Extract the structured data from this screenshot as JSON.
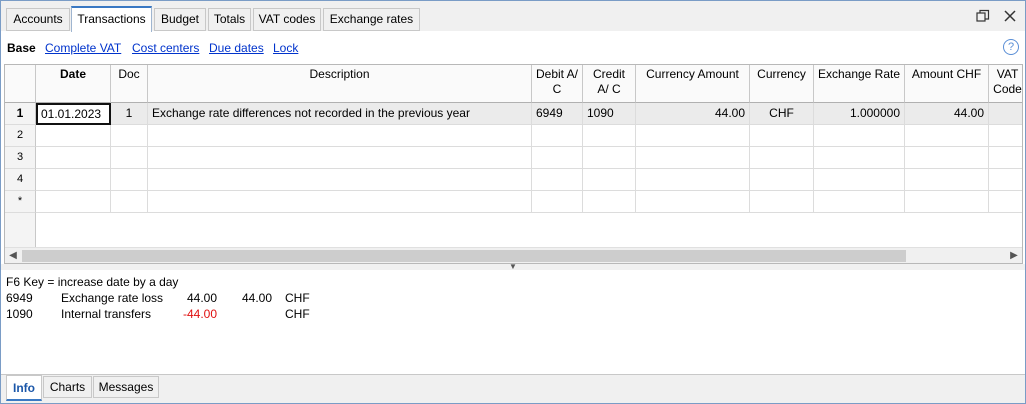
{
  "top_tabs": [
    "Accounts",
    "Transactions",
    "Budget",
    "Totals",
    "VAT codes",
    "Exchange rates"
  ],
  "active_top_tab": "Transactions",
  "views": [
    "Base",
    "Complete VAT",
    "Cost centers",
    "Due dates",
    "Lock"
  ],
  "current_view": "Base",
  "help_label": "?",
  "columns": {
    "date": "Date",
    "doc": "Doc",
    "description": "Description",
    "debit": "Debit A/ C",
    "credit": "Credit A/ C",
    "currency_amount": "Currency Amount",
    "currency": "Currency",
    "exchange_rate": "Exchange Rate",
    "amount_chf": "Amount CHF",
    "vat_code": "VAT Code"
  },
  "rows": [
    {
      "num": "1",
      "date": "01.01.2023",
      "doc": "1",
      "description": "Exchange rate differences not recorded in the previous year",
      "debit": "6949",
      "credit": "1090",
      "currency_amount": "44.00",
      "currency": "CHF",
      "exchange_rate": "1.000000",
      "amount_chf": "44.00",
      "vat_code": ""
    },
    {
      "num": "2"
    },
    {
      "num": "3"
    },
    {
      "num": "4"
    },
    {
      "num": "*"
    }
  ],
  "info": {
    "hint": "F6 Key = increase date by a day",
    "accounts": [
      {
        "account": "6949",
        "name": "Exchange rate loss",
        "amount": "44.00",
        "balance": "44.00",
        "currency": "CHF"
      },
      {
        "account": "1090",
        "name": "Internal transfers",
        "amount": "-44.00",
        "balance": "",
        "currency": "CHF"
      }
    ]
  },
  "bottom_tabs": [
    "Info",
    "Charts",
    "Messages"
  ],
  "active_bottom_tab": "Info",
  "colors": {
    "accent": "#3a78c3",
    "link": "#0033cc",
    "negative": "#e01010"
  }
}
